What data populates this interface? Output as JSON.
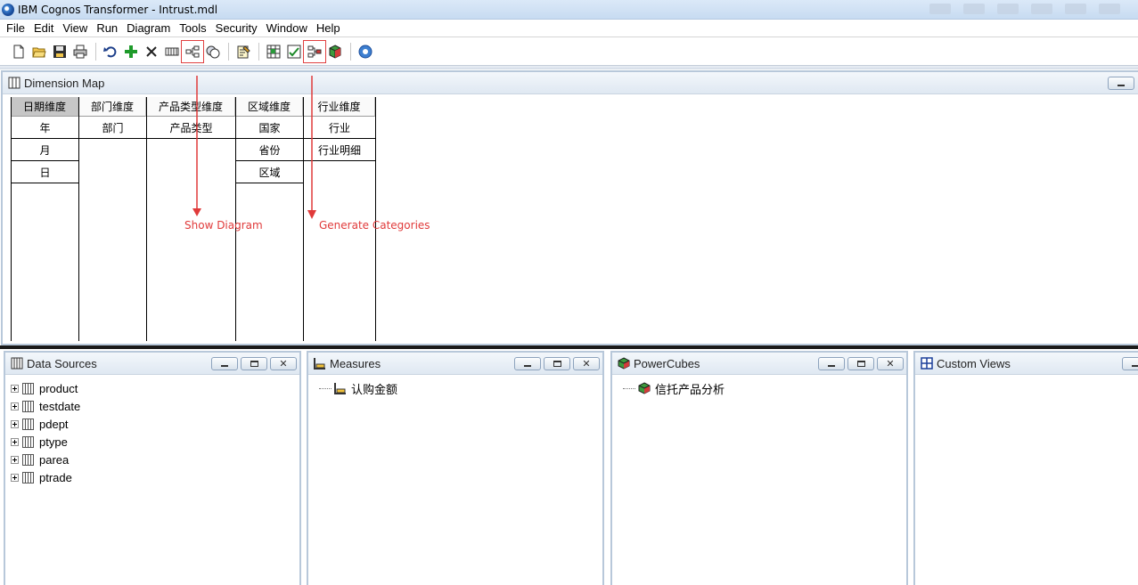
{
  "window": {
    "title": "IBM Cognos Transformer - Intrust.mdl"
  },
  "menu": [
    "File",
    "Edit",
    "View",
    "Run",
    "Diagram",
    "Tools",
    "Security",
    "Window",
    "Help"
  ],
  "toolbar": {
    "buttons": [
      "new-file-icon",
      "open-folder-icon",
      "save-icon",
      "print-icon",
      "undo-icon",
      "add-icon",
      "delete-icon",
      "insert-column-icon",
      "show-diagram-icon",
      "check-model-icon",
      "edit-properties-icon",
      "show-scope-icon",
      "powercube-check-icon",
      "generate-categories-icon",
      "create-powercube-icon",
      "help-icon"
    ]
  },
  "dimension_map": {
    "title": "Dimension Map",
    "columns": [
      {
        "header": "日期维度",
        "levels": [
          "年",
          "月",
          "日"
        ]
      },
      {
        "header": "部门维度",
        "levels": [
          "部门"
        ]
      },
      {
        "header": "产品类型维度",
        "levels": [
          "产品类型"
        ]
      },
      {
        "header": "区域维度",
        "levels": [
          "国家",
          "省份",
          "区域"
        ]
      },
      {
        "header": "行业维度",
        "levels": [
          "行业",
          "行业明细"
        ]
      }
    ]
  },
  "annotations": {
    "show_diagram": "Show Diagram",
    "generate_categories": "Generate Categories",
    "color": "#e03a3a"
  },
  "data_sources": {
    "title": "Data Sources",
    "items": [
      "product",
      "testdate",
      "pdept",
      "ptype",
      "parea",
      "ptrade"
    ]
  },
  "measures": {
    "title": "Measures",
    "items": [
      "认购金额"
    ]
  },
  "powercubes": {
    "title": "PowerCubes",
    "items": [
      "信托产品分析"
    ]
  },
  "custom_views": {
    "title": "Custom Views"
  },
  "window_buttons": {
    "close_glyph": "✕"
  }
}
